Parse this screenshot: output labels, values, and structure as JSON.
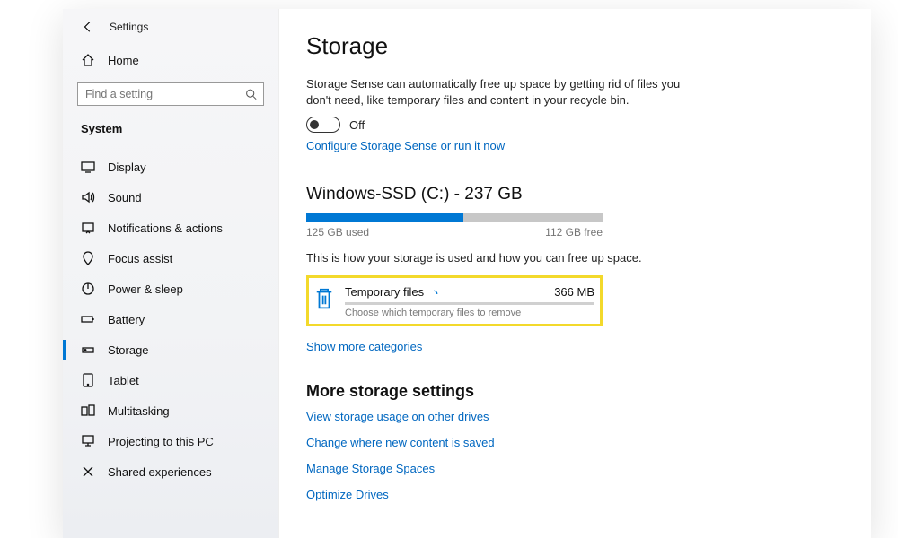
{
  "header": {
    "app_title": "Settings"
  },
  "sidebar": {
    "home_label": "Home",
    "search_placeholder": "Find a setting",
    "section": "System",
    "items": [
      {
        "label": "Display"
      },
      {
        "label": "Sound"
      },
      {
        "label": "Notifications & actions"
      },
      {
        "label": "Focus assist"
      },
      {
        "label": "Power & sleep"
      },
      {
        "label": "Battery"
      },
      {
        "label": "Storage"
      },
      {
        "label": "Tablet"
      },
      {
        "label": "Multitasking"
      },
      {
        "label": "Projecting to this PC"
      },
      {
        "label": "Shared experiences"
      }
    ]
  },
  "main": {
    "title": "Storage",
    "sense_desc": "Storage Sense can automatically free up space by getting rid of files you don't need, like temporary files and content in your recycle bin.",
    "toggle_state": "Off",
    "configure_link": "Configure Storage Sense or run it now",
    "drive": {
      "heading": "Windows-SSD (C:) - 237 GB",
      "used_pct": 53,
      "used_label": "125 GB used",
      "free_label": "112 GB free",
      "usage_desc": "This is how your storage is used and how you can free up space."
    },
    "category": {
      "name": "Temporary files",
      "size": "366 MB",
      "subtitle": "Choose which temporary files to remove"
    },
    "show_more": "Show more categories",
    "more_heading": "More storage settings",
    "more_links": [
      "View storage usage on other drives",
      "Change where new content is saved",
      "Manage Storage Spaces",
      "Optimize Drives"
    ]
  }
}
